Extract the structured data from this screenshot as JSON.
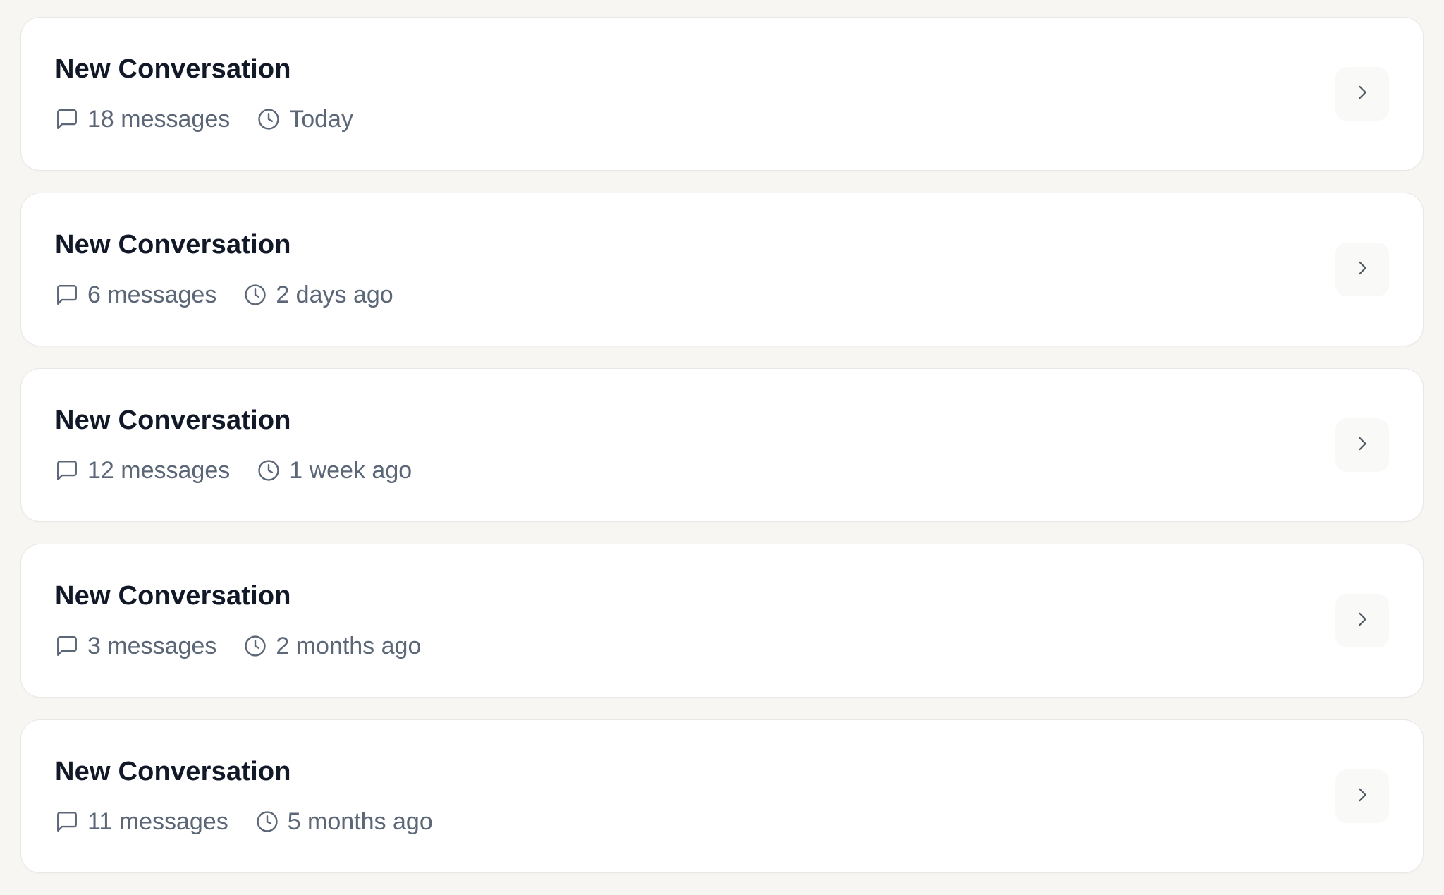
{
  "conversations": [
    {
      "title": "New Conversation",
      "messages": "18 messages",
      "time": "Today"
    },
    {
      "title": "New Conversation",
      "messages": "6 messages",
      "time": "2 days ago"
    },
    {
      "title": "New Conversation",
      "messages": "12 messages",
      "time": "1 week ago"
    },
    {
      "title": "New Conversation",
      "messages": "3 messages",
      "time": "2 months ago"
    },
    {
      "title": "New Conversation",
      "messages": "11 messages",
      "time": "5 months ago"
    }
  ],
  "icons": {
    "messages": "message-square-icon",
    "time": "clock-icon",
    "open": "chevron-right-icon"
  },
  "colors": {
    "background": "#f8f6f3",
    "card": "#ffffff",
    "title": "#111827",
    "meta": "#5b6677"
  }
}
